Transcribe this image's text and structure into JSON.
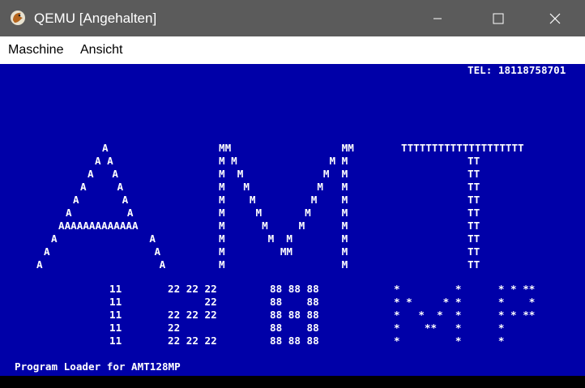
{
  "window": {
    "title": "QEMU [Angehalten]",
    "icon": "qemu-logo-icon",
    "controls": [
      "minimize-icon",
      "maximize-icon",
      "close-icon"
    ]
  },
  "menu": {
    "items": [
      "Maschine",
      "Ansicht"
    ]
  },
  "screen": {
    "background": "#0000a8",
    "foreground": "#ffffff",
    "tel": "TEL: 18118758701",
    "banner": {
      "A": [
        "A",
        "A A",
        "A   A",
        "A     A",
        "A       A",
        "A         A",
        "AAAAAAAAAAAAA",
        "A               A",
        "A                 A",
        "A                   A"
      ],
      "M": [
        "MM                  MM",
        "M M               M M",
        "M  M             M  M",
        "M   M           M   M",
        "M    M         M    M",
        "M     M       M     M",
        "M      M     M      M",
        "M       M  M        M",
        "M         MM        M",
        "M                   M"
      ],
      "T": [
        "TTTTTTTTTTTTTTTTTTTT",
        "TT",
        "TT",
        "TT",
        "TT",
        "TT",
        "TT",
        "TT",
        "TT",
        "TT"
      ]
    },
    "numbers": {
      "col11": [
        "11",
        "11",
        "11",
        "11",
        "11"
      ],
      "col22": [
        "22 22 22",
        "      22",
        "22 22 22",
        "22",
        "22 22 22"
      ],
      "col88": [
        "88 88 88",
        "88    88",
        "88 88 88",
        "88    88",
        "88 88 88"
      ],
      "stars": [
        "*         *      * * **",
        "* *     * *      *    *",
        "*   *  *  *      * * **",
        "*    **   *      *",
        "*         *      *"
      ]
    },
    "footer": "Program Loader for AMT128MP"
  }
}
